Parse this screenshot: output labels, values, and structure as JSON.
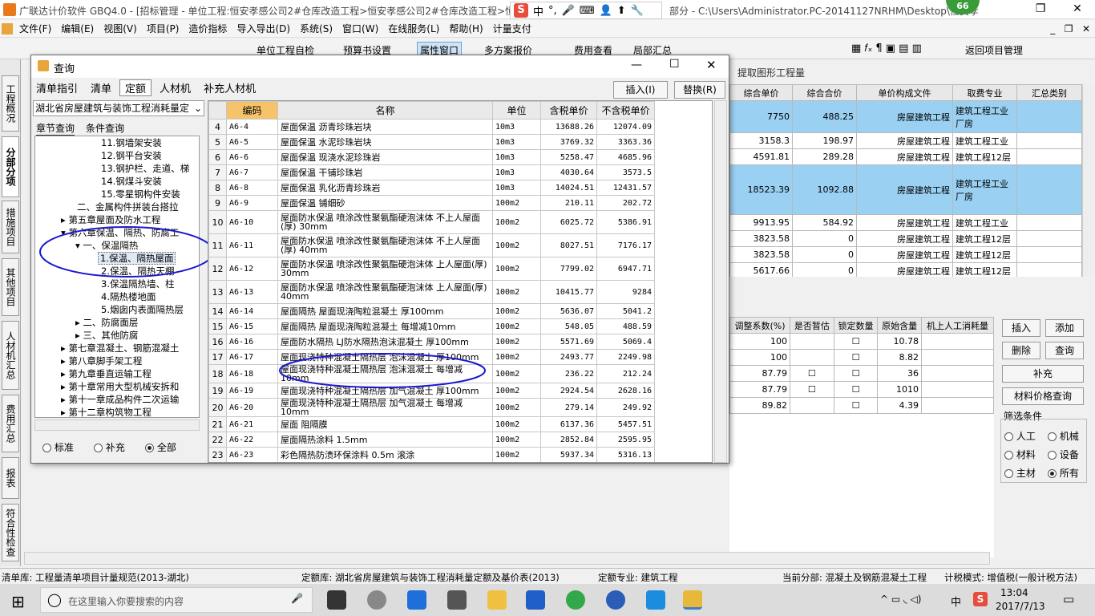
{
  "app": {
    "title": "广联达计价软件 GBQ4.0 - [招标管理 - 单位工程:恒安孝感公司2#仓库改造工程>恒安孝感公司2#仓库改造工程>恒安孝",
    "title_tail": "部分 - C:\\Users\\Administrator.PC-20141127NRHM\\Desktop\\恒安孝",
    "badge": "66"
  },
  "menu": [
    "文件(F)",
    "编辑(E)",
    "视图(V)",
    "项目(P)",
    "造价指标",
    "导入导出(D)",
    "系统(S)",
    "窗口(W)",
    "在线服务(L)",
    "帮助(H)",
    "计量支付"
  ],
  "toolbar": {
    "items": [
      "单位工程自检",
      "预算书设置",
      "属性窗口",
      "多方案报价",
      "费用查看",
      "局部汇总",
      "返回项目管理"
    ],
    "extract": "提取图形工程量"
  },
  "left_tabs": [
    "工程概况",
    "分部分项",
    "措施项目",
    "其他项目",
    "人材机汇总",
    "费用汇总",
    "报表",
    "符合性检查"
  ],
  "right_grid": {
    "headers": [
      "综合单价",
      "综合合价",
      "单价构成文件",
      "取费专业",
      "汇总类别"
    ],
    "rows": [
      [
        "7750",
        "488.25",
        "房屋建筑工程",
        "建筑工程工业厂房",
        ""
      ],
      [
        "3158.3",
        "198.97",
        "房屋建筑工程",
        "建筑工程工业",
        ""
      ],
      [
        "4591.81",
        "289.28",
        "房屋建筑工程",
        "建筑工程12层",
        ""
      ],
      [
        "18523.39",
        "1092.88",
        "房屋建筑工程",
        "建筑工程工业厂房",
        ""
      ],
      [
        "9913.95",
        "584.92",
        "房屋建筑工程",
        "建筑工程工业",
        ""
      ],
      [
        "3823.58",
        "0",
        "房屋建筑工程",
        "建筑工程12层",
        ""
      ],
      [
        "3823.58",
        "0",
        "房屋建筑工程",
        "建筑工程12层",
        ""
      ],
      [
        "5617.66",
        "0",
        "房屋建筑工程",
        "建筑工程12层",
        ""
      ]
    ]
  },
  "lower_grid": {
    "headers": [
      "调整系数(%)",
      "是否暂估",
      "锁定数量",
      "原始含量",
      "机上人工消耗量"
    ],
    "rows": [
      [
        "100",
        "",
        "☐",
        "10.78"
      ],
      [
        "100",
        "",
        "☐",
        "8.82"
      ],
      [
        "87.79",
        "☐",
        "☐",
        "36"
      ],
      [
        "87.79",
        "☐",
        "☐",
        "1010"
      ],
      [
        "89.82",
        "",
        "☐",
        "4.39"
      ]
    ]
  },
  "side_buttons": {
    "insert": "插入",
    "add": "添加",
    "delete": "删除",
    "query": "查询",
    "supplement": "补充",
    "price_query": "材料价格查询",
    "filter_title": "筛选条件",
    "filters": [
      "人工",
      "机械",
      "材料",
      "设备",
      "主材",
      "所有"
    ],
    "filter_selected": "所有"
  },
  "dialog": {
    "title": "查询",
    "tabs": [
      "清单指引",
      "清单",
      "定额",
      "人材机",
      "补充人材机"
    ],
    "active_tab": "定额",
    "btn_insert": "插入(I)",
    "btn_replace": "替换(R)",
    "library": "湖北省房屋建筑与装饰工程消耗量定",
    "subtabs": [
      "章节查询",
      "条件查询"
    ],
    "tree": [
      "12.钢平台安装",
      "13.钢护栏、走道、梯",
      "14.钢煤斗安装",
      "15.零星钢构件安装",
      "二、金属构件拼装台搭拉",
      "第五章屋面及防水工程",
      "第六章保温、隔热、防腐工",
      "一、保温隔热",
      "1.保温、隔热屋面",
      "2.保温、隔热天棚",
      "3.保温隔热墙、柱",
      "4.隔热楼地面",
      "5.烟囱内表面隔热层",
      "二、防腐面层",
      "三、其他防腐",
      "第七章混凝土、钢筋混凝土",
      "第八章脚手架工程",
      "第九章垂直运输工程",
      "第十章常用大型机械安拆和",
      "第十一章成品构件二次运输",
      "第十二章构筑物工程"
    ],
    "tree_head": "11.钢墙架安装",
    "radios": [
      "标准",
      "补充",
      "全部"
    ],
    "radio_selected": "全部",
    "headers": [
      "编码",
      "名称",
      "单位",
      "含税单价",
      "不含税单价"
    ],
    "rows": [
      [
        "4",
        "A6-4",
        "屋面保温 沥青珍珠岩块",
        "10m3",
        "13688.26",
        "12074.09"
      ],
      [
        "5",
        "A6-5",
        "屋面保温 水泥珍珠岩块",
        "10m3",
        "3769.32",
        "3363.36"
      ],
      [
        "6",
        "A6-6",
        "屋面保温 现浇水泥珍珠岩",
        "10m3",
        "5258.47",
        "4685.96"
      ],
      [
        "7",
        "A6-7",
        "屋面保温 干铺珍珠岩",
        "10m3",
        "4030.64",
        "3573.5"
      ],
      [
        "8",
        "A6-8",
        "屋面保温 乳化沥青珍珠岩",
        "10m3",
        "14024.51",
        "12431.57"
      ],
      [
        "9",
        "A6-9",
        "屋面保温 铺细砂",
        "100m2",
        "210.11",
        "202.72"
      ],
      [
        "10",
        "A6-10",
        "屋面防水保温 喷涂改性聚氨酯硬泡沫体 不上人屋面(厚) 30mm",
        "100m2",
        "6025.72",
        "5386.91"
      ],
      [
        "11",
        "A6-11",
        "屋面防水保温 喷涂改性聚氨酯硬泡沫体 不上人屋面(厚) 40mm",
        "100m2",
        "8027.51",
        "7176.17"
      ],
      [
        "12",
        "A6-12",
        "屋面防水保温 喷涂改性聚氨酯硬泡沫体 上人屋面(厚) 30mm",
        "100m2",
        "7799.02",
        "6947.71"
      ],
      [
        "13",
        "A6-13",
        "屋面防水保温 喷涂改性聚氨酯硬泡沫体 上人屋面(厚) 40mm",
        "100m2",
        "10415.77",
        "9284"
      ],
      [
        "14",
        "A6-14",
        "屋面隔热 屋面现浇陶粒混凝土 厚100mm",
        "100m2",
        "5636.07",
        "5041.2"
      ],
      [
        "15",
        "A6-15",
        "屋面隔热 屋面现浇陶粒混凝土 每增减10mm",
        "100m2",
        "548.05",
        "488.59"
      ],
      [
        "16",
        "A6-16",
        "屋面防水隔热 LJ防水隔热泡沫混凝土 厚100mm",
        "100m2",
        "5571.69",
        "5069.4"
      ],
      [
        "17",
        "A6-17",
        "屋面现浇特种混凝土隔热层 泡沫混凝土 厚100mm",
        "100m2",
        "2493.77",
        "2249.98"
      ],
      [
        "18",
        "A6-18",
        "屋面现浇特种混凝土隔热层 泡沫混凝土 每增减10mm",
        "100m2",
        "236.22",
        "212.24"
      ],
      [
        "19",
        "A6-19",
        "屋面现浇特种混凝土隔热层 加气混凝土 厚100mm",
        "100m2",
        "2924.54",
        "2628.16"
      ],
      [
        "20",
        "A6-20",
        "屋面现浇特种混凝土隔热层 加气混凝土 每增减10mm",
        "100m2",
        "279.14",
        "249.92"
      ],
      [
        "21",
        "A6-21",
        "屋面 阻隔膜",
        "100m2",
        "6137.36",
        "5457.51"
      ],
      [
        "22",
        "A6-22",
        "屋面隔热涂料 1.5mm",
        "100m2",
        "2852.84",
        "2595.95"
      ],
      [
        "23",
        "A6-23",
        "彩色隔热防渍环保涂料 0.5m 滚涂",
        "100m2",
        "5937.34",
        "5316.13"
      ]
    ]
  },
  "status": {
    "list_lib": "清单库: 工程量清单项目计量规范(2013-湖北)",
    "quota_lib": "定额库: 湖北省房屋建筑与装饰工程消耗量定额及基价表(2013)",
    "quota_major": "定额专业: 建筑工程",
    "current": "当前分部: 混凝土及钢筋混凝土工程",
    "mode": "计税模式: 增值税(一般计税方法)"
  },
  "taskbar": {
    "search": "在这里输入你要搜索的内容",
    "time": "13:04",
    "date": "2017/7/13",
    "lang": "中"
  }
}
